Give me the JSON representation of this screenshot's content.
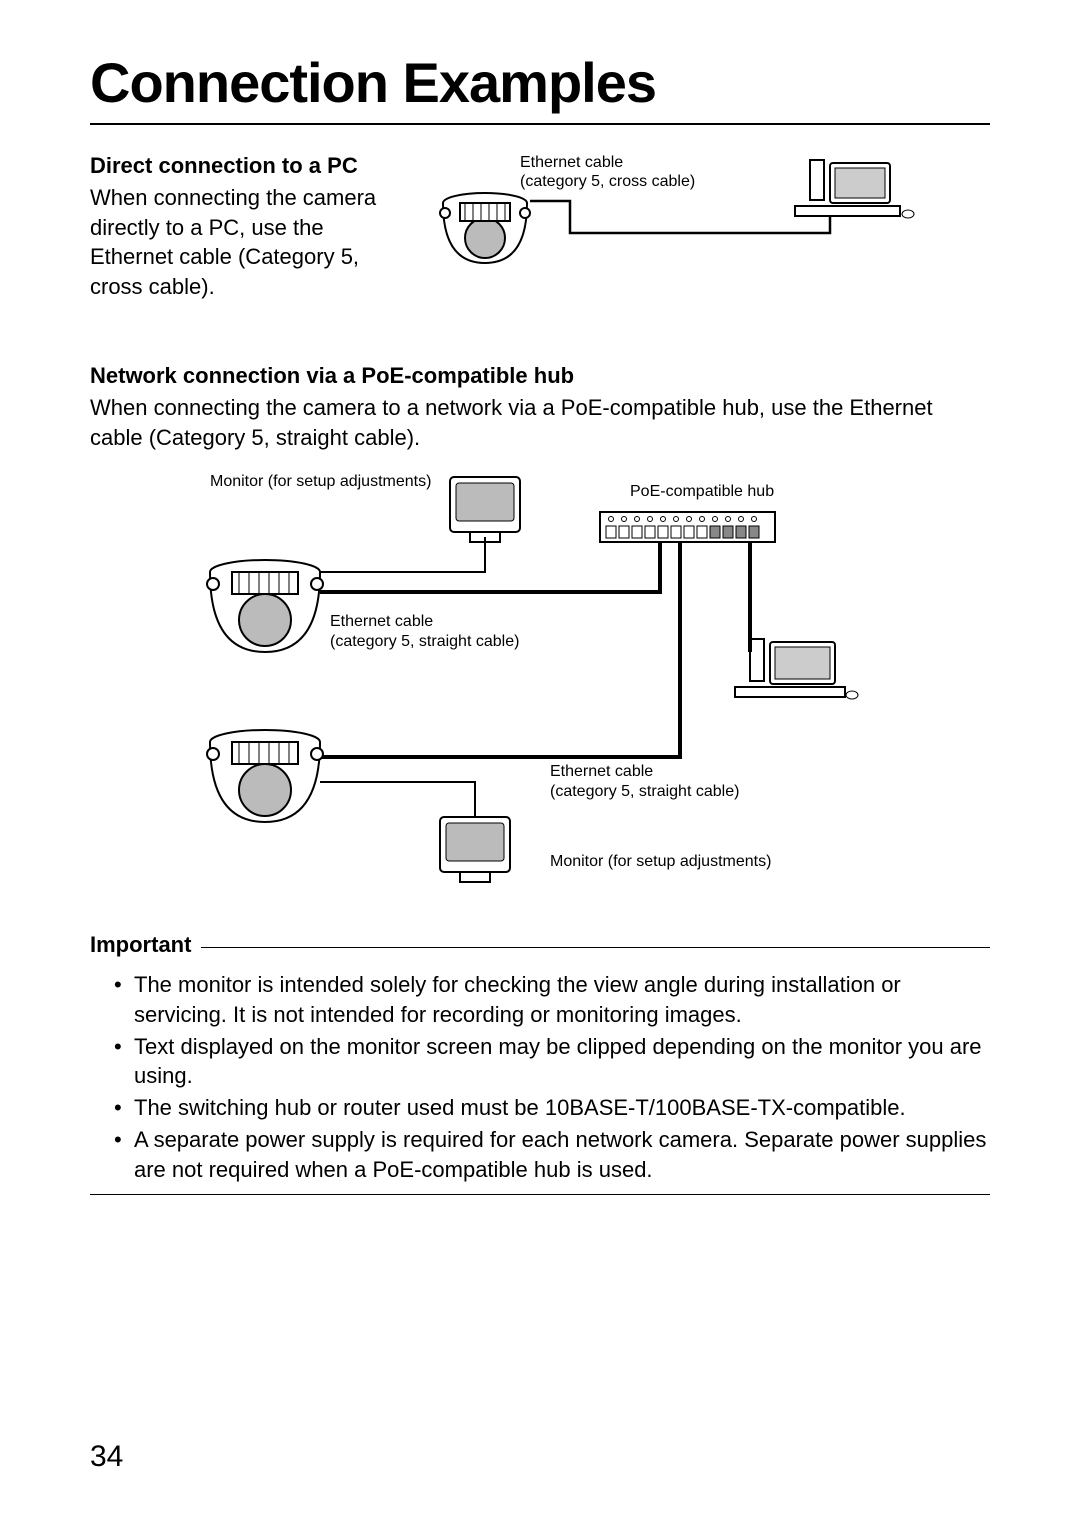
{
  "page_title": "Connection Examples",
  "section1": {
    "title": "Direct connection to a PC",
    "body": "When connecting the camera directly to a PC, use the Ethernet cable (Category 5, cross cable).",
    "cable_label_line1": "Ethernet cable",
    "cable_label_line2": "(category 5, cross cable)"
  },
  "section2": {
    "title": "Network connection via a PoE-compatible hub",
    "body": "When connecting the camera to a network via a PoE-compatible hub, use the Ethernet cable (Category 5, straight cable).",
    "labels": {
      "monitor_top": "Monitor (for setup adjustments)",
      "hub": "PoE-compatible hub",
      "cable1_l1": "Ethernet cable",
      "cable1_l2": "(category 5, straight cable)",
      "cable2_l1": "Ethernet cable",
      "cable2_l2": "(category 5, straight cable)",
      "monitor_bottom": "Monitor (for setup adjustments)"
    }
  },
  "important": {
    "heading": "Important",
    "items": [
      "The monitor is intended solely for checking the view angle during installation or servicing. It is not intended for recording or monitoring images.",
      "Text displayed on the monitor screen may be clipped depending on the monitor you are using.",
      "The switching hub or router used must be 10BASE-T/100BASE-TX-compatible.",
      "A separate power supply is required for each network camera. Separate power supplies are not required when a PoE-compatible hub is used."
    ]
  },
  "page_number": "34"
}
